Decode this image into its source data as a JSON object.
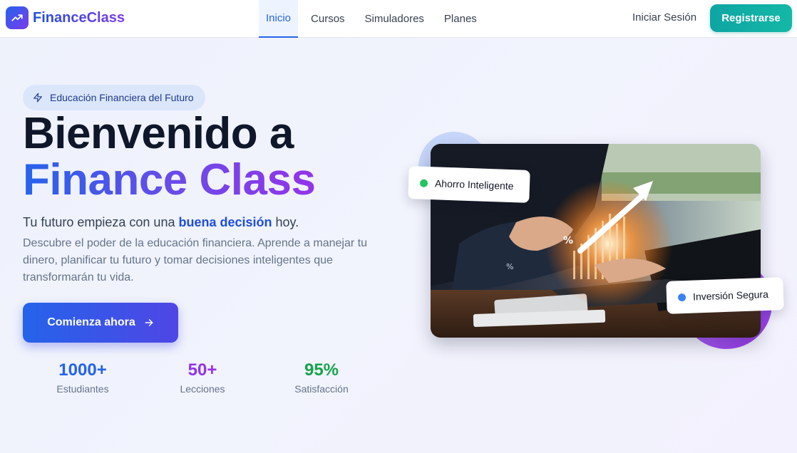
{
  "brand": {
    "name": "FinanceClass",
    "logo_icon": "trending-up-icon"
  },
  "nav": {
    "links": [
      {
        "label": "Inicio",
        "active": true
      },
      {
        "label": "Cursos",
        "active": false
      },
      {
        "label": "Simuladores",
        "active": false
      },
      {
        "label": "Planes",
        "active": false
      }
    ],
    "login_label": "Iniciar Sesión",
    "register_label": "Registrarse"
  },
  "hero": {
    "badge": {
      "icon": "lightning-icon",
      "text": "Educación Financiera del Futuro"
    },
    "title_line1": "Bienvenido a",
    "title_line2": "Finance Class",
    "tagline": {
      "before": "Tu futuro empieza con una ",
      "highlight": "buena decisión",
      "after": " hoy."
    },
    "description": "Descubre el poder de la educación financiera. Aprende a manejar tu dinero, planificar tu futuro y tomar decisiones inteligentes que transformarán tu vida.",
    "cta_label": "Comienza ahora",
    "cta_icon": "arrow-right-icon"
  },
  "stats": [
    {
      "value": "1000+",
      "label": "Estudiantes",
      "color": "#2563eb"
    },
    {
      "value": "50+",
      "label": "Lecciones",
      "color": "#9333ea"
    },
    {
      "value": "95%",
      "label": "Satisfacción",
      "color": "#16a34a"
    }
  ],
  "image_cards": [
    {
      "label": "Ahorro Inteligente",
      "dot_color": "#22c55e"
    },
    {
      "label": "Inversión Segura",
      "dot_color": "#3b82f6"
    }
  ],
  "colors": {
    "primary": "#2563eb",
    "accent_purple": "#9333ea",
    "teal": "#14b8a6"
  }
}
